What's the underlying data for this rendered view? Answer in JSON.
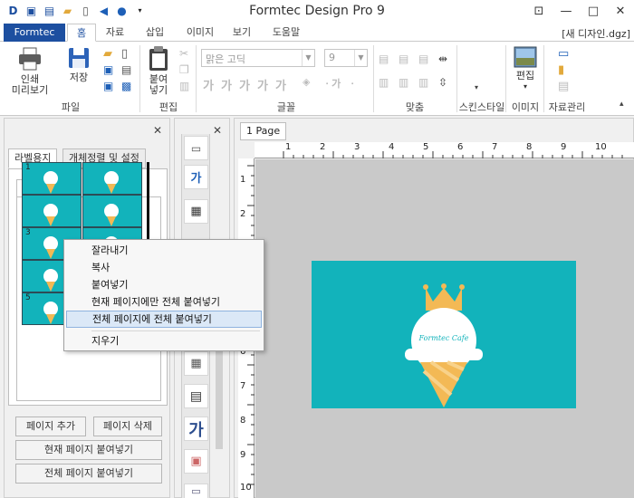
{
  "window": {
    "title": "Formtec Design Pro 9",
    "doc_name": "[새 디자인.dgz]"
  },
  "ribbon_tabs": [
    {
      "label": "Formtec"
    },
    {
      "label": "홈"
    },
    {
      "label": "자료"
    },
    {
      "label": "삽입"
    },
    {
      "label": "이미지"
    },
    {
      "label": "보기"
    },
    {
      "label": "도움말"
    }
  ],
  "ribbon": {
    "print_preview": "인쇄\n미리보기",
    "save": "저장",
    "paste": "붙여\n넣기",
    "font_name": "맑은 고딕",
    "font_size": "9",
    "edit_image": "편집",
    "groups": {
      "file": "파일",
      "edit": "편집",
      "font": "글꼴",
      "align": "맞춤",
      "skin_style": "스킨스타일",
      "image": "이미지",
      "resource": "자료관리"
    }
  },
  "left_panel": {
    "tabs": [
      "라벨용지",
      "개체정렬 및 설정"
    ],
    "page_tab": "1P",
    "thumb_numbers": [
      "1",
      "3",
      "5"
    ],
    "buttons": {
      "add_page": "페이지 추가",
      "delete_page": "페이지 삭제",
      "paste_current": "현재 페이지 붙여넣기",
      "paste_all": "전체 페이지 붙여넣기"
    }
  },
  "canvas": {
    "page_tab": "1 Page",
    "hruler_labels": [
      "1",
      "2",
      "3",
      "4",
      "5",
      "6",
      "7",
      "8",
      "9",
      "10"
    ],
    "vruler_labels": [
      "1",
      "2",
      "3",
      "4",
      "5",
      "6",
      "7",
      "8",
      "9",
      "10"
    ],
    "card_text": "Formtec Cafe",
    "card_color": "#12b3bb"
  },
  "context_menu": {
    "items": [
      "잘라내기",
      "복사",
      "붙여넣기",
      "현재 페이지에만 전체 붙여넣기",
      "전체 페이지에 전체 붙여넣기",
      "지우기"
    ],
    "highlighted_index": 4
  },
  "toolbox": {
    "text_tool": "가"
  }
}
